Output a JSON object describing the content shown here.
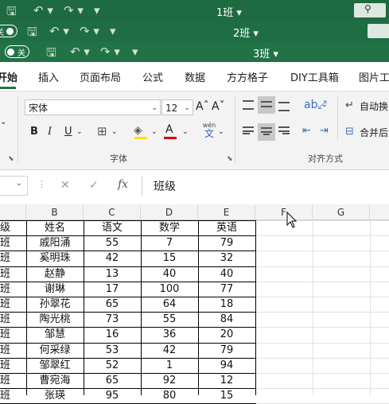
{
  "windows": [
    {
      "title": "1班 ▾",
      "toggle": ""
    },
    {
      "title": "2班 ▾",
      "toggle": "关"
    },
    {
      "title": "3班 ▾",
      "toggle": "关"
    }
  ],
  "tabs": [
    "开始",
    "插入",
    "页面布局",
    "公式",
    "数据",
    "方方格子",
    "DIY工具箱",
    "图片工"
  ],
  "ribbon": {
    "font_name": "宋体",
    "font_size": "12",
    "bold": "B",
    "italic": "I",
    "underline": "U",
    "grow_font": "Aˆ",
    "shrink_font": "Aˇ",
    "wen_label": "wén",
    "wen_char": "文",
    "font_group": "字体",
    "align_group": "对齐方式",
    "wrap_label": "自动换",
    "merge_label": "合并后"
  },
  "formula_bar": {
    "cancel": "✕",
    "confirm": "✓",
    "fx": "fx",
    "content": "班级"
  },
  "columns": [
    "B",
    "C",
    "D",
    "E",
    "F",
    "G"
  ],
  "rows": [
    {
      "a": "级",
      "b": "姓名",
      "c": "语文",
      "d": "数学",
      "e": "英语"
    },
    {
      "a": "班",
      "b": "戚阳涌",
      "c": "55",
      "d": "7",
      "e": "79"
    },
    {
      "a": "班",
      "b": "奚明珠",
      "c": "42",
      "d": "15",
      "e": "32"
    },
    {
      "a": "班",
      "b": "赵静",
      "c": "13",
      "d": "40",
      "e": "40"
    },
    {
      "a": "班",
      "b": "谢琳",
      "c": "17",
      "d": "100",
      "e": "77"
    },
    {
      "a": "班",
      "b": "孙翠花",
      "c": "65",
      "d": "64",
      "e": "18"
    },
    {
      "a": "班",
      "b": "陶光桃",
      "c": "73",
      "d": "55",
      "e": "84"
    },
    {
      "a": "班",
      "b": "邹慧",
      "c": "16",
      "d": "36",
      "e": "20"
    },
    {
      "a": "班",
      "b": "何采绿",
      "c": "53",
      "d": "42",
      "e": "79"
    },
    {
      "a": "班",
      "b": "邹翠红",
      "c": "52",
      "d": "1",
      "e": "94"
    },
    {
      "a": "班",
      "b": "曹宛海",
      "c": "65",
      "d": "92",
      "e": "12"
    },
    {
      "a": "班",
      "b": "张瑛",
      "c": "95",
      "d": "80",
      "e": "15"
    }
  ]
}
